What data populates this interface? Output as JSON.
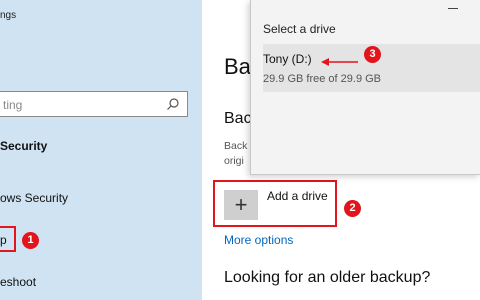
{
  "sidebar": {
    "title": "ngs",
    "search_placeholder": "ting",
    "items": [
      {
        "label": "Security",
        "bold": true
      },
      {
        "label": "ows Security",
        "bold": false
      },
      {
        "label": "p",
        "bold": false
      },
      {
        "label": "eshoot",
        "bold": false
      }
    ]
  },
  "main": {
    "heading": "Bac",
    "subheading": "Back",
    "description": "Back\norigi",
    "add_drive_label": "Add a drive",
    "plus_symbol": "+",
    "more_options": "More options",
    "older_backup": "Looking for an older backup?"
  },
  "popup": {
    "title": "Select a drive",
    "drive_name": "Tony (D:)",
    "drive_free": "29.9 GB free of 29.9 GB"
  },
  "annotations": {
    "badge1": "1",
    "badge2": "2",
    "badge3": "3",
    "color": "#e3141b"
  }
}
